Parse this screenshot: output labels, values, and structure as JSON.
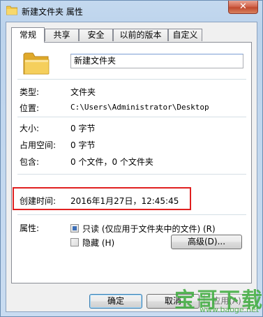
{
  "window": {
    "title": "新建文件夹 属性",
    "close_glyph": "✕"
  },
  "tabs": [
    {
      "label": "常规",
      "active": true
    },
    {
      "label": "共享",
      "active": false
    },
    {
      "label": "安全",
      "active": false
    },
    {
      "label": "以前的版本",
      "active": false
    },
    {
      "label": "自定义",
      "active": false
    }
  ],
  "general": {
    "name_value": "新建文件夹",
    "rows": [
      {
        "label": "类型:",
        "value": "文件夹"
      },
      {
        "label": "位置:",
        "value": "C:\\Users\\Administrator\\Desktop"
      },
      {
        "label": "大小:",
        "value": "0 字节"
      },
      {
        "label": "占用空间:",
        "value": "0 字节"
      },
      {
        "label": "包含:",
        "value": "0 个文件，0 个文件夹"
      },
      {
        "label": "创建时间:",
        "value": "2016年1月27日，12:45:45"
      }
    ],
    "attributes_label": "属性:",
    "readonly_label": "只读 (仅应用于文件夹中的文件) (R)",
    "hidden_label": "隐藏 (H)",
    "advanced_label": "高级(D)..."
  },
  "buttons": {
    "ok": "确定",
    "cancel": "取消",
    "apply": "应用(A)"
  },
  "watermark": {
    "big": "宝哥下载",
    "small": "www.baoge.net"
  },
  "colors": {
    "highlight_box": "#e02020",
    "folder": "#f2c84b",
    "watermark": "#3cab3c"
  },
  "icons": {
    "title": "folder-icon",
    "main": "folder-icon",
    "close": "close-icon"
  }
}
